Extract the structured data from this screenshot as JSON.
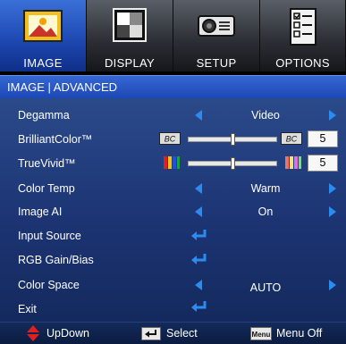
{
  "tabs": [
    {
      "label": "IMAGE",
      "icon": "image-icon",
      "active": true
    },
    {
      "label": "DISPLAY",
      "icon": "display-icon",
      "active": false
    },
    {
      "label": "SETUP",
      "icon": "projector-icon",
      "active": false
    },
    {
      "label": "OPTIONS",
      "icon": "options-icon",
      "active": false
    }
  ],
  "title": "IMAGE | ADVANCED",
  "rows": {
    "degamma": {
      "label": "Degamma",
      "value": "Video"
    },
    "brilliantcolor": {
      "label": "BrilliantColor™",
      "value": "5",
      "level": 0.5,
      "icon_left": "BC",
      "icon_right": "BC"
    },
    "truevivid": {
      "label": "TrueVivid™",
      "value": "5",
      "level": 0.5
    },
    "colortemp": {
      "label": "Color Temp",
      "value": "Warm"
    },
    "imageai": {
      "label": "Image AI",
      "value": "On"
    },
    "inputsource": {
      "label": "Input Source"
    },
    "rgbgain": {
      "label": "RGB Gain/Bias"
    },
    "colorspace": {
      "label": "Color Space",
      "value": "AUTO"
    },
    "exit": {
      "label": "Exit"
    }
  },
  "footer": {
    "updown": "UpDown",
    "select": "Select",
    "menu_icon_text": "Menu",
    "menuoff": "Menu Off"
  },
  "colors": {
    "accent_blue": "#2a8cf0",
    "active_tab": "#2a5bc9",
    "updown_red": "#e02020"
  }
}
